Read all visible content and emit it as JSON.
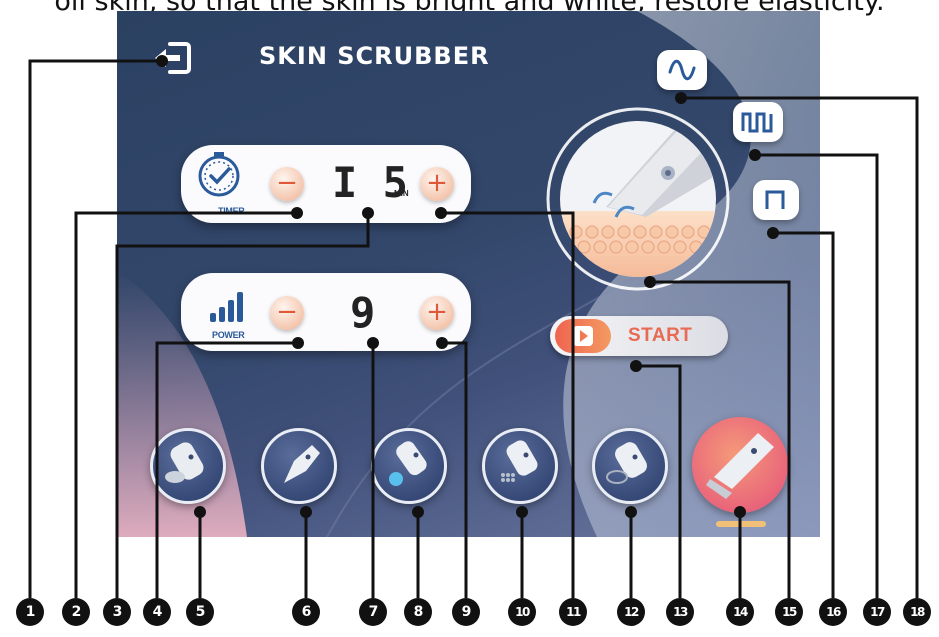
{
  "caption": "oil skin, so that the skin is bright and white, restore elasticity.",
  "app": {
    "title": "SKIN  SCRUBBER"
  },
  "timer": {
    "label": "TIMER",
    "value": "I 5",
    "unit": "MIN",
    "minus": "−",
    "plus": "+"
  },
  "power": {
    "label": "POWER",
    "value": "9",
    "minus": "−",
    "plus": "+"
  },
  "start": {
    "label": "START"
  },
  "waveforms": [
    "sine-wave-icon",
    "pulse-train-icon",
    "single-pulse-icon"
  ],
  "heads": [
    {
      "icon": "flat-round-head-icon"
    },
    {
      "icon": "cone-head-icon"
    },
    {
      "icon": "blue-tip-head-icon"
    },
    {
      "icon": "brush-head-icon"
    },
    {
      "icon": "ring-head-icon"
    },
    {
      "icon": "scrubber-blade-head-icon",
      "active": true
    }
  ],
  "callouts": [
    "1",
    "2",
    "3",
    "4",
    "5",
    "6",
    "7",
    "8",
    "9",
    "10",
    "11",
    "12",
    "13",
    "14",
    "15",
    "16",
    "17",
    "18"
  ],
  "colors": {
    "screen_bg": "#2b4162",
    "accent": "#e8604e",
    "start_text": "#e86a52",
    "panel": "#fbfbfd"
  }
}
